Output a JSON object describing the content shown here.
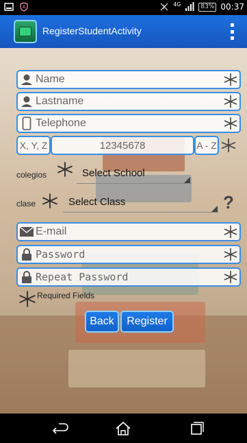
{
  "status_bar": {
    "network": "4G",
    "battery": "83%",
    "time": "00:37"
  },
  "action_bar": {
    "title": "RegisterStudentActivity",
    "app_icon": "app-icon",
    "menu_icon": "overflow-menu-icon"
  },
  "form": {
    "name": {
      "placeholder": "Name",
      "icon": "person-icon"
    },
    "lastname": {
      "placeholder": "Lastname",
      "icon": "person-icon"
    },
    "telephone": {
      "placeholder": "Telephone",
      "icon": "phone-icon"
    },
    "id_prefix": "X, Y, Z",
    "id_number": "12345678",
    "id_letter": "A - Z",
    "school_label": "colegios",
    "school_select": "Select School",
    "class_label": "clase",
    "class_select": "Select Class",
    "help": "?",
    "email": {
      "placeholder": "E-mail",
      "icon": "mail-icon"
    },
    "password": {
      "placeholder": "Password",
      "icon": "lock-icon"
    },
    "repeat_password": {
      "placeholder": "Repeat Password",
      "icon": "lock-icon"
    },
    "required_note": "Required Fields"
  },
  "buttons": {
    "back": "Back",
    "register": "Register"
  },
  "nav_bar": {
    "back_icon": "back-icon",
    "home_icon": "home-icon",
    "recents_icon": "recents-icon"
  },
  "colors": {
    "accent": "#1d6fe0",
    "field_border": "#3a8ee6"
  }
}
